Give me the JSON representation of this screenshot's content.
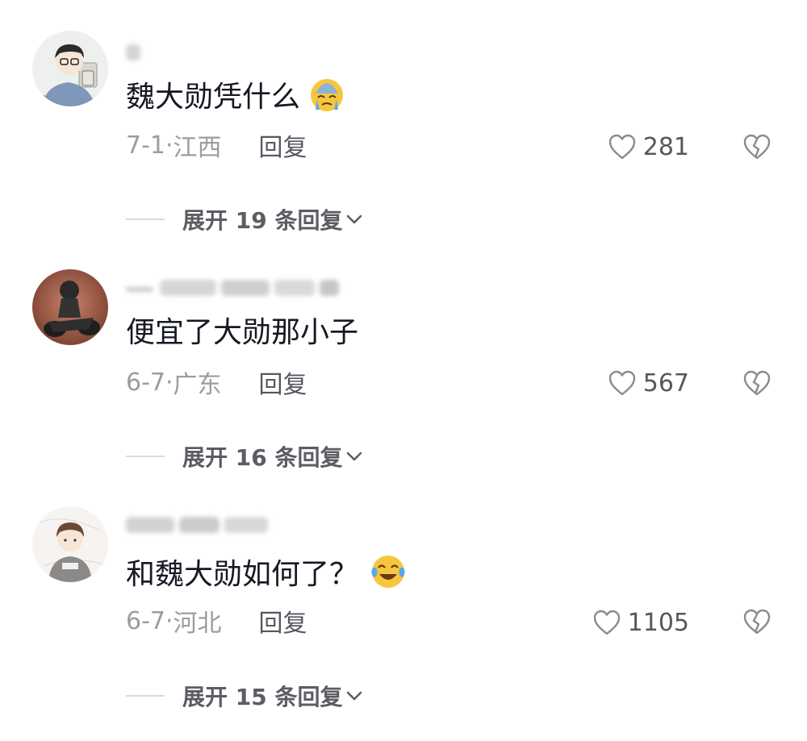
{
  "comments": [
    {
      "text": "魏大勋凭什么",
      "emoji": "crying-face-emoji",
      "date": "7-1·",
      "location": "江西",
      "reply_label": "回复",
      "likes": "281",
      "expand_label": "展开 19 条回复"
    },
    {
      "text": "便宜了大勋那小子",
      "emoji": "",
      "date": "6-7·",
      "location": "广东",
      "reply_label": "回复",
      "likes": "567",
      "expand_label": "展开 16 条回复"
    },
    {
      "text": "和魏大勋如何了？",
      "emoji": "laughing-tears-emoji",
      "date": "6-7·",
      "location": "河北",
      "reply_label": "回复",
      "likes": "1105",
      "expand_label": "展开 15 条回复"
    }
  ],
  "icons": {
    "like": "heart-outline-icon",
    "dislike": "broken-heart-icon",
    "expand": "chevron-down-icon"
  },
  "colors": {
    "text": "#161823",
    "meta": "#9b9ca1",
    "icon": "#8a8b90"
  }
}
